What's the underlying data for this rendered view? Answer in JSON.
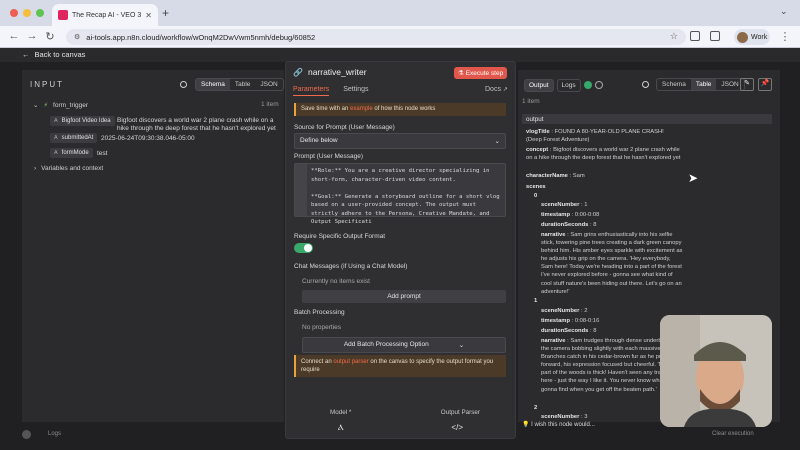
{
  "browser": {
    "tab_title": "The Recap AI - VEO 3 Bigf",
    "url": "ai-tools.app.n8n.cloud/workflow/wOnqM2DwVwm5nmh/debug/60852",
    "profile_label": "Work",
    "traffic_colors": [
      "#ee5d55",
      "#f4bd3c",
      "#5fc454"
    ]
  },
  "app": {
    "back_label": "Back to canvas"
  },
  "input_panel": {
    "title": "INPUT",
    "view_tabs": [
      "Schema",
      "Table",
      "JSON"
    ],
    "active_view": "Schema",
    "node_name": "form_trigger",
    "item_count": "1 item",
    "fields": [
      {
        "type_icon": "A",
        "name": "Bigfoot Video Idea",
        "value": "Bigfoot discovers a world war 2 plane crash while on a hike through the deep forest that he hasn't explored yet"
      },
      {
        "type_icon": "A",
        "name": "submittedAt",
        "value": "2025-06-24T09:30:38.046-05:00"
      },
      {
        "type_icon": "A",
        "name": "formMode",
        "value": "test"
      }
    ],
    "vars_label": "Variables and context"
  },
  "node": {
    "name": "narrative_writer",
    "execute_label": "Execute step",
    "tabs": [
      "Parameters",
      "Settings"
    ],
    "active_tab": "Parameters",
    "docs_label": "Docs",
    "tip_prefix": "Save time with an ",
    "tip_link": "example",
    "tip_suffix": " of how this node works",
    "source_label": "Source for Prompt (User Message)",
    "source_value": "Define below",
    "prompt_label": "Prompt (User Message)",
    "prompt_text": "**Role:** You are a creative director specializing in short-form, character-driven video content.\n\n**Goal:** Generate a storyboard outline for a short vlog based on a user-provided concept. The output must strictly adhere to the Persona, Creative Mandate, and Output Specificati",
    "require_label": "Require Specific Output Format",
    "chat_label": "Chat Messages (if Using a Chat Model)",
    "chat_empty": "Currently no items exist",
    "add_prompt": "Add prompt",
    "batch_label": "Batch Processing",
    "no_props": "No properties",
    "add_batch": "Add Batch Processing Option",
    "connect_prefix": "Connect an ",
    "connect_link": "output parser",
    "connect_suffix": " on the canvas to specify the output format you require",
    "model_label": "Model *",
    "parser_label": "Output Parser"
  },
  "output_panel": {
    "tabs": [
      "Output",
      "Logs"
    ],
    "active_tab": "Output",
    "view_tabs": [
      "Schema",
      "Table",
      "JSON"
    ],
    "active_view": "Table",
    "item_count": "1 item",
    "header": "output",
    "vlogTitle_key": "vlogTitle",
    "vlogTitle": "FOUND A 80-YEAR-OLD PLANE CRASH! (Deep Forest Adventure)",
    "concept_key": "concept",
    "concept": "Bigfoot discovers a world war 2 plane crash while on a hike through the deep forest that he hasn't explored yet",
    "characterName_key": "characterName",
    "characterName": "Sam",
    "scenes_key": "scenes",
    "scene0_index": "0",
    "scene0_sceneNumber": "1",
    "scene0_timestamp": "0:00-0:08",
    "scene0_duration": "8",
    "scene0_narrative": "Sam grins enthusiastically into his selfie stick, towering pine trees creating a dark green canopy behind him. His amber eyes sparkle with excitement as he adjusts his grip on the camera. 'Hey everybody, Sam here! Today we're heading into a part of the forest I've never explored before - gonna see what kind of cool stuff nature's been hiding out there. Let's go on an adventure!'",
    "scene1_index": "1",
    "scene1_sceneNumber": "2",
    "scene1_timestamp": "0:08-0:16",
    "scene1_duration": "8",
    "scene1_narrative": "Sam trudges through dense underbrush, the camera bobbing slightly with each massive step. Branches catch in his cedar-brown fur as he pushes forward, his expression focused but cheerful. 'Man, this part of the woods is thick! Haven't seen any trails out here - just the way I like it. You never know what you're gonna find when you get off the beaten path.'",
    "scene2_index": "2",
    "scene2_sceneNumber": "3",
    "sceneNumber_key": "sceneNumber",
    "timestamp_key": "timestamp",
    "duration_key": "durationSeconds",
    "narrative_key": "narrative",
    "wish_text": "I wish this node would..."
  },
  "footer": {
    "logs_label": "Logs",
    "clear_label": "Clear execution"
  }
}
